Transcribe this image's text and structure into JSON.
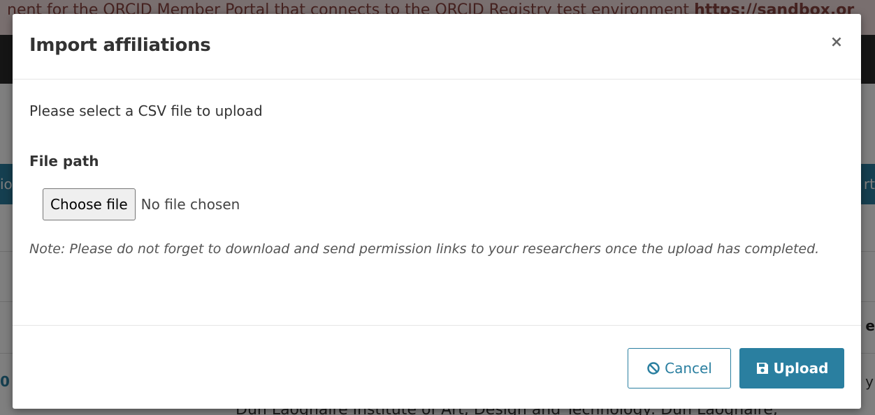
{
  "background": {
    "banner_text": "nent for the ORCID Member Portal that connects to the ORCID Registry test environment ",
    "banner_url": "https://sandbox.or",
    "toolbar_left": "io",
    "toolbar_right": "rt",
    "column_header_fragment": "e",
    "row_number_fragment": "0",
    "row_right_fragment": "y",
    "row_text": "Dún Laoghaire Institute of Art, Design and Technology: Dún Laoghaire,"
  },
  "modal": {
    "title": "Import affiliations",
    "close_symbol": "×",
    "intro_text": "Please select a CSV file to upload",
    "file_label": "File path",
    "choose_file_label": "Choose file",
    "no_file_text": "No file chosen",
    "note": "Note: Please do not forget to download and send permission links to your researchers once the upload has completed.",
    "cancel_label": "Cancel",
    "upload_label": "Upload",
    "cancel_icon": "ban-icon",
    "upload_icon": "save-icon"
  },
  "colors": {
    "accent": "#2a7fa0",
    "banner_bg": "#f2dede",
    "navbar_bg": "#2b2b2b"
  }
}
